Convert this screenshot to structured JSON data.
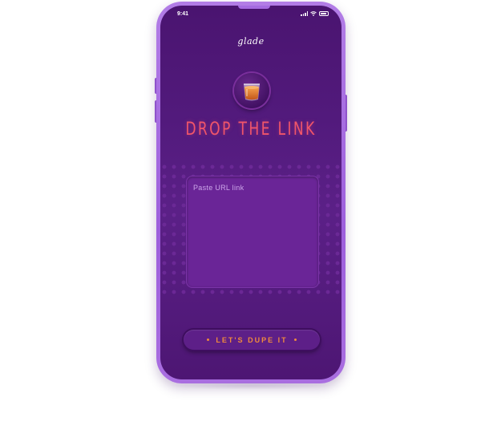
{
  "status_bar": {
    "time": "9:41"
  },
  "brand": {
    "logo_text": "glade"
  },
  "hero": {
    "icon": "candle-icon",
    "headline": "DROP THE LINK"
  },
  "url_input": {
    "placeholder": "Paste URL link",
    "value": ""
  },
  "cta": {
    "label": "LET'S DUPE IT"
  },
  "colors": {
    "screen_background": "#521a7c",
    "frame": "#a96ee0",
    "headline": "#f0556a",
    "cta_text": "#f08a3c",
    "input_background": "#6a2597"
  }
}
